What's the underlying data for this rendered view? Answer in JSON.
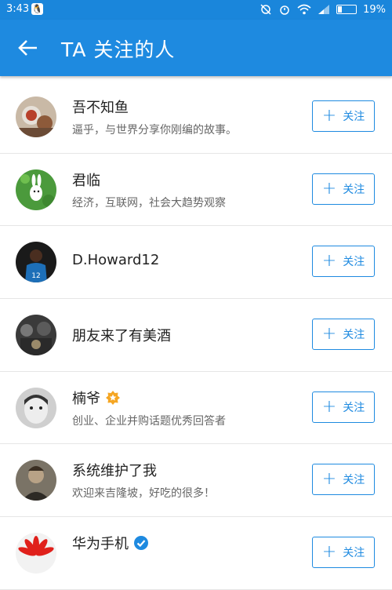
{
  "status": {
    "time": "3:43",
    "battery": "19%",
    "battery_level": 0.19
  },
  "header": {
    "title": "TA 关注的人"
  },
  "users": [
    {
      "name": "吾不知鱼",
      "desc": "逼乎，与世界分享你刚编的故事。",
      "follow_label": "关注"
    },
    {
      "name": "君临",
      "desc": "经济，互联网，社会大趋势观察",
      "follow_label": "关注"
    },
    {
      "name": "D.Howard12",
      "desc": "",
      "follow_label": "关注"
    },
    {
      "name": "朋友来了有美酒",
      "desc": "",
      "follow_label": "关注"
    },
    {
      "name": "楠爷",
      "desc": "创业、企业并购话题优秀回答者",
      "follow_label": "关注"
    },
    {
      "name": "系统维护了我",
      "desc": "欢迎来吉隆坡，好吃的很多！",
      "follow_label": "关注"
    },
    {
      "name": "华为手机",
      "desc": "",
      "follow_label": "关注"
    }
  ],
  "icons": {
    "back": "arrow-left-icon",
    "plus": "plus-icon",
    "verified": "check-badge-icon",
    "excellent": "star-badge-icon"
  },
  "colors": {
    "primary": "#1e8ae0"
  }
}
